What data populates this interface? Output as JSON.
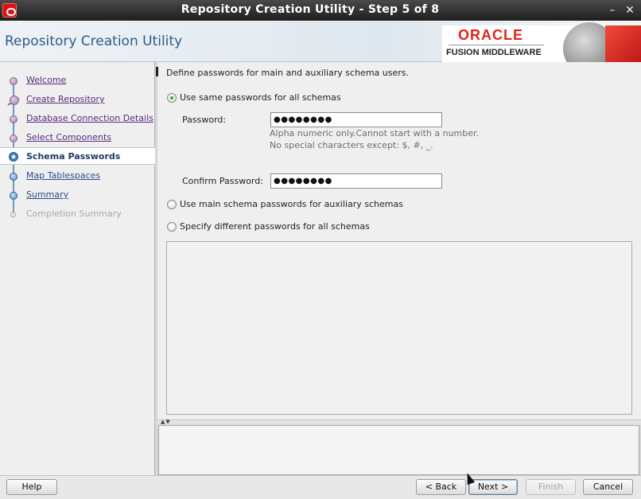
{
  "window": {
    "title": "Repository Creation Utility - Step 5 of 8",
    "minimize_glyph": "–",
    "close_glyph": "✕"
  },
  "header": {
    "app_title": "Repository Creation Utility",
    "brand_line1": "ORACLE",
    "brand_line2": "FUSION MIDDLEWARE"
  },
  "steps": [
    {
      "label": "Welcome",
      "state": "done"
    },
    {
      "label": "Create Repository",
      "state": "done"
    },
    {
      "label": "Database Connection Details",
      "state": "done"
    },
    {
      "label": "Select Components",
      "state": "done"
    },
    {
      "label": "Schema Passwords",
      "state": "current"
    },
    {
      "label": "Map Tablespaces",
      "state": "pending"
    },
    {
      "label": "Summary",
      "state": "pending"
    },
    {
      "label": "Completion Summary",
      "state": "disabled"
    }
  ],
  "main": {
    "intro": "Define passwords for main and auxiliary schema users.",
    "option_same": "Use same passwords for all schemas",
    "password_label": "Password:",
    "password_value": "●●●●●●●●",
    "hint_line1": "Alpha numeric only.Cannot start with a number.",
    "hint_line2": "No special characters except: $, #, _.",
    "confirm_label": "Confirm Password:",
    "confirm_value": "●●●●●●●●",
    "option_main": "Use main schema passwords for auxiliary schemas",
    "option_different": "Specify different passwords for all schemas"
  },
  "buttons": {
    "help": "Help",
    "back": "< Back",
    "next": "Next >",
    "finish": "Finish",
    "cancel": "Cancel"
  }
}
